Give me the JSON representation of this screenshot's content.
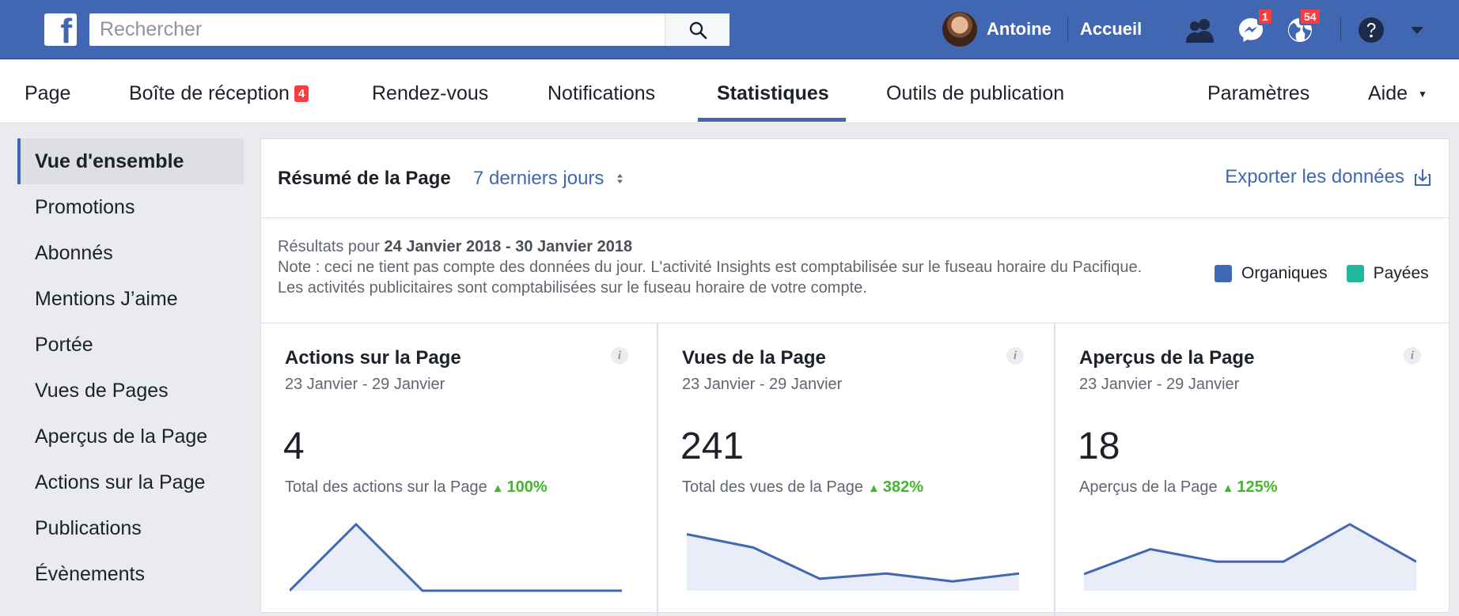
{
  "topbar": {
    "logo_letter": "f",
    "search_placeholder": "Rechercher",
    "user_name": "Antoine",
    "home_label": "Accueil",
    "messenger_badge": "1",
    "notifications_badge": "54",
    "colors": {
      "bar": "#4267b2",
      "badge": "#fa3e3e"
    }
  },
  "pagenav": {
    "page": "Page",
    "inbox": "Boîte de réception",
    "inbox_badge": "4",
    "appointments": "Rendez-vous",
    "notifications": "Notifications",
    "insights": "Statistiques",
    "publishing_tools": "Outils de publication",
    "settings": "Paramètres",
    "help": "Aide",
    "help_caret": "▼"
  },
  "sidebar": {
    "items": [
      {
        "label": "Vue d'ensemble"
      },
      {
        "label": "Promotions"
      },
      {
        "label": "Abonnés"
      },
      {
        "label": "Mentions J’aime"
      },
      {
        "label": "Portée"
      },
      {
        "label": "Vues de Pages"
      },
      {
        "label": "Aperçus de la Page"
      },
      {
        "label": "Actions sur la Page"
      },
      {
        "label": "Publications"
      },
      {
        "label": "Évènements"
      }
    ]
  },
  "summary": {
    "title": "Résumé de la Page",
    "range": "7 derniers jours",
    "export": "Exporter les données",
    "results_prefix": "Résultats pour",
    "results_range": "24 Janvier 2018 - 30 Janvier 2018",
    "note": "Note : ceci ne tient pas compte des données du jour. L'activité Insights est comptabilisée sur le fuseau horaire du Pacifique. Les activités publicitaires sont comptabilisées sur le fuseau horaire de votre compte.",
    "legend": [
      {
        "label": "Organiques",
        "color": "#4267b2"
      },
      {
        "label": "Payées",
        "color": "#20b89a"
      }
    ]
  },
  "cards": [
    {
      "title": "Actions sur la Page",
      "range": "23 Janvier - 29 Janvier",
      "value": "4",
      "subtitle": "Total des actions sur la Page",
      "delta": "100%",
      "spark": [
        0,
        3,
        0,
        0,
        0,
        0
      ],
      "spark_max": 3
    },
    {
      "title": "Vues de la Page",
      "range": "23 Janvier - 29 Janvier",
      "value": "241",
      "subtitle": "Total des vues de la Page",
      "delta": "382%",
      "spark": [
        85,
        65,
        18,
        26,
        14,
        26
      ],
      "spark_max": 100
    },
    {
      "title": "Aperçus de la Page",
      "range": "23 Janvier - 29 Janvier",
      "value": "18",
      "subtitle": "Aperçus de la Page",
      "delta": "125%",
      "spark": [
        2,
        5,
        3.5,
        3.5,
        8,
        3.5
      ],
      "spark_max": 8
    }
  ]
}
